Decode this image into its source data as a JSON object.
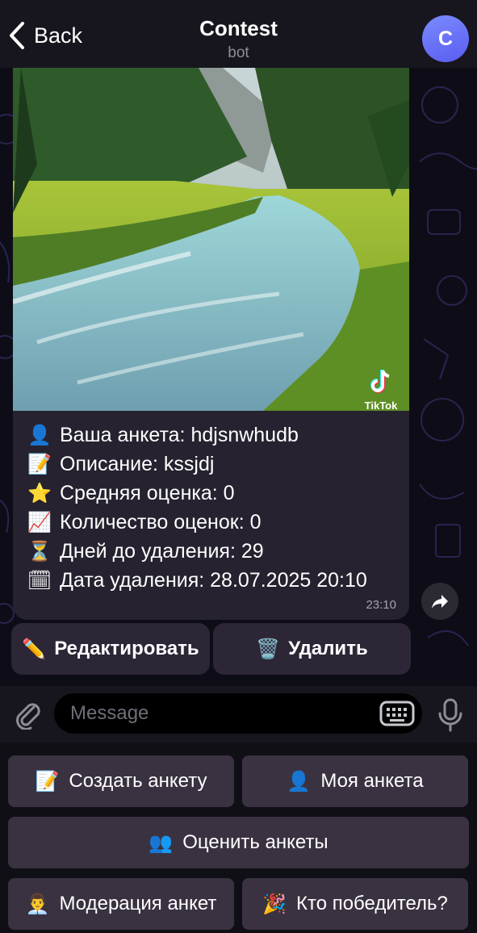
{
  "header": {
    "back_label": "Back",
    "title": "Contest",
    "subtitle": "bot",
    "avatar_letter": "C"
  },
  "message": {
    "watermark": "TikTok",
    "lines": [
      {
        "icon": "bust-in-silhouette-icon",
        "text": "Ваша анкета: hdjsnwhudb"
      },
      {
        "icon": "memo-icon",
        "text": "Описание: kssjdj"
      },
      {
        "icon": "star-icon",
        "text": "Средняя оценка: 0"
      },
      {
        "icon": "chart-increasing-icon",
        "text": "Количество оценок: 0"
      },
      {
        "icon": "hourglass-icon",
        "text": "Дней до удаления: 29"
      },
      {
        "icon": "calendar-icon",
        "text": "Дата удаления: 28.07.2025 20:10"
      }
    ],
    "time": "23:10"
  },
  "inline_buttons": {
    "edit": {
      "icon": "pencil-icon",
      "label": "Редактировать"
    },
    "delete": {
      "icon": "wastebasket-icon",
      "label": "Удалить"
    }
  },
  "input": {
    "placeholder": "Message"
  },
  "keyboard": {
    "create": {
      "icon": "memo-icon",
      "label": "Создать анкету"
    },
    "mine": {
      "icon": "bust-in-silhouette-icon",
      "label": "Моя анкета"
    },
    "rate": {
      "icon": "busts-in-silhouette-icon",
      "label": "Оценить анкеты"
    },
    "moderation": {
      "icon": "office-worker-icon",
      "label": "Модерация анкет"
    },
    "winner": {
      "icon": "party-popper-icon",
      "label": "Кто победитель?"
    }
  },
  "colors": {
    "accent": "#5a5cf0",
    "bubble": "#26222f",
    "keyboard_button": "#3a3241"
  }
}
